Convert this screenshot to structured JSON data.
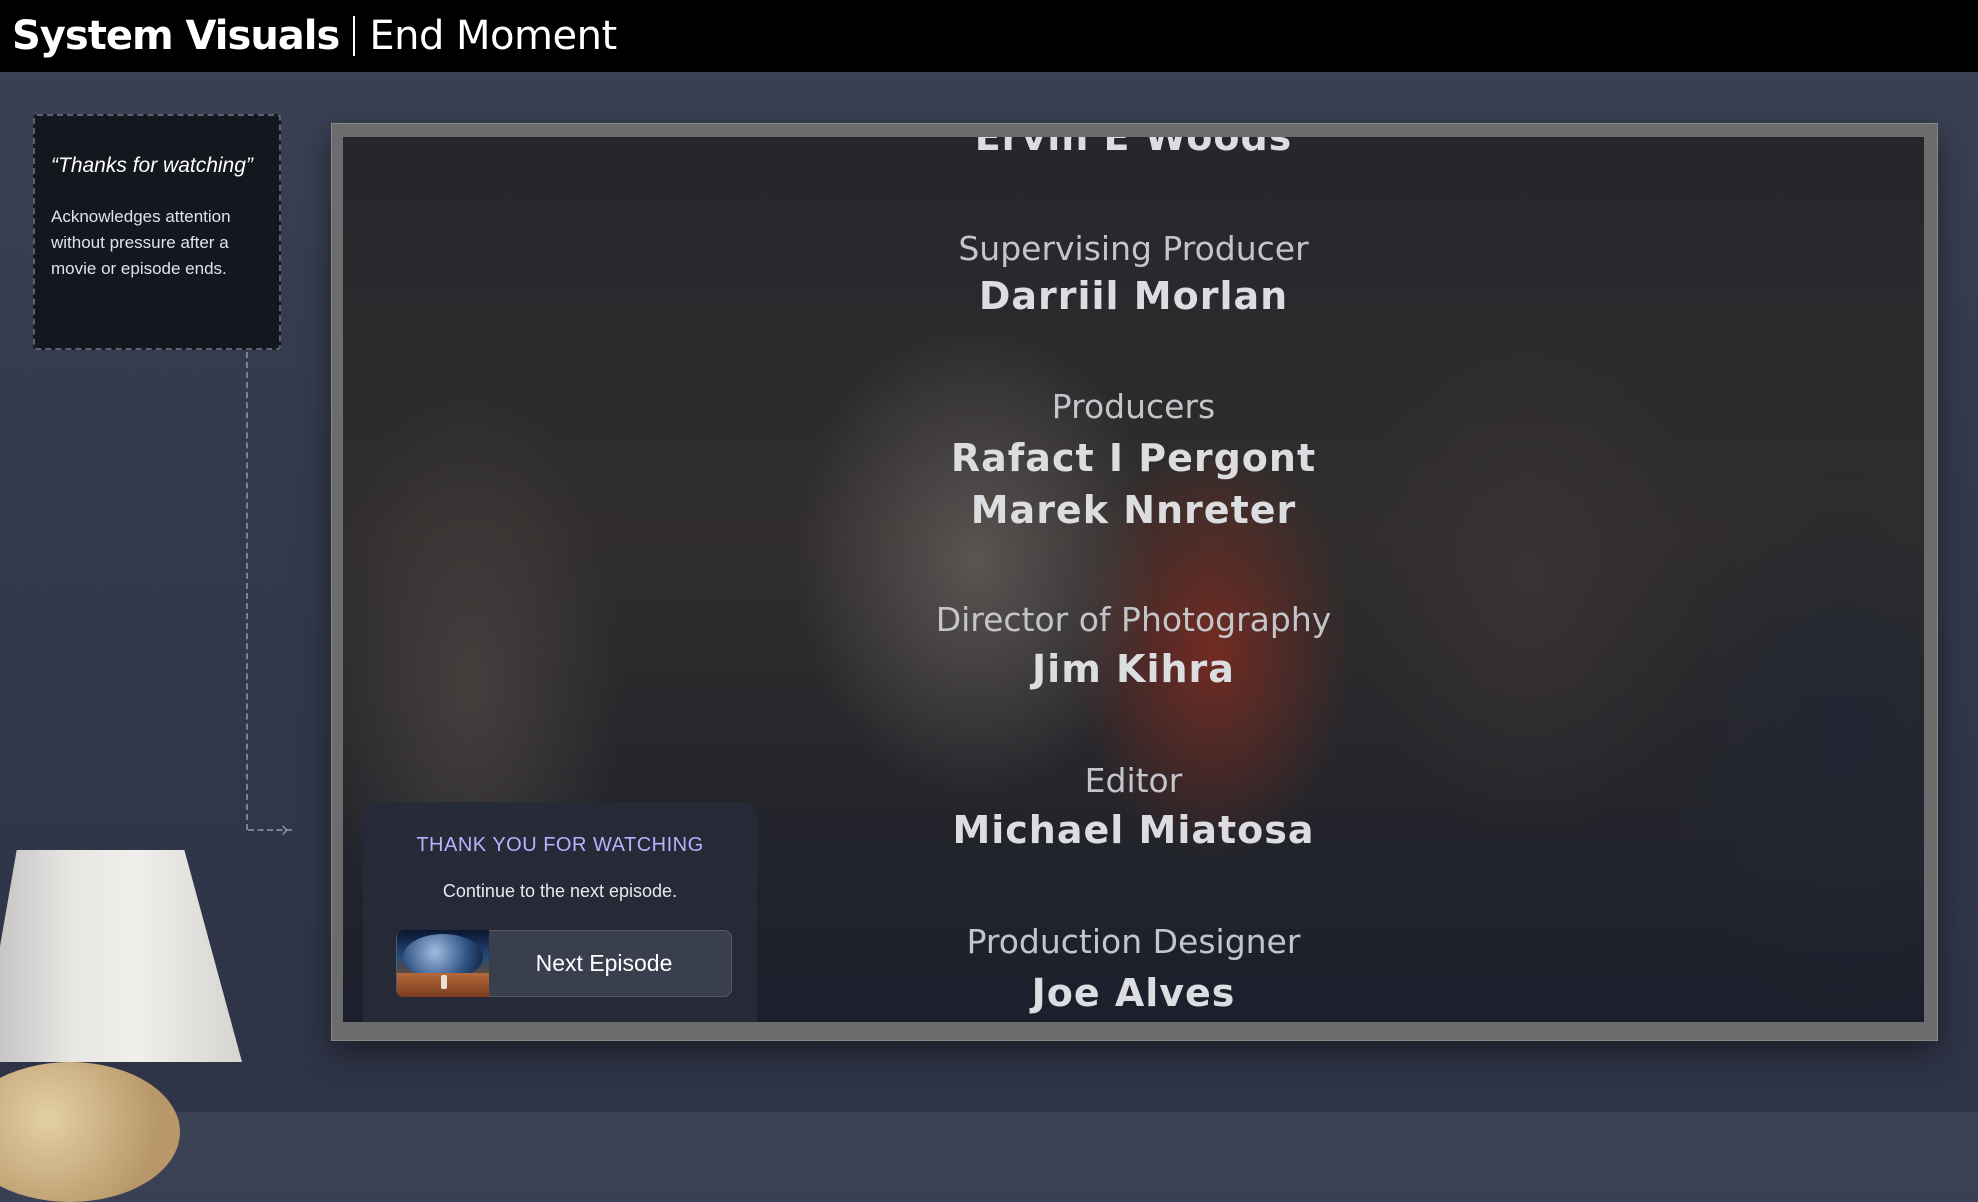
{
  "header": {
    "brand": "System Visuals",
    "subtitle": "End Moment"
  },
  "note": {
    "title": "“Thanks for watching”",
    "body": "Acknowledges attention without pressure after a movie or episode ends."
  },
  "credits": [
    {
      "role": "",
      "names": [
        "Ervin E Woods"
      ]
    },
    {
      "role": "Supervising Producer",
      "names": [
        "Darriil Morlan"
      ]
    },
    {
      "role": "Producers",
      "names": [
        "Rafact I Pergont",
        "Marek Nnreter"
      ]
    },
    {
      "role": "Director of Photography",
      "names": [
        "Jim Kihra"
      ]
    },
    {
      "role": "Editor",
      "names": [
        "Michael Miatosa"
      ]
    },
    {
      "role": "Production Designer",
      "names": [
        "Joe Alves"
      ]
    }
  ],
  "end_card": {
    "heading": "THANK YOU FOR WATCHING",
    "subtext": "Continue to the next episode.",
    "next_button_label": "Next Episode"
  },
  "icons": {
    "arrow": "arrow-right-icon",
    "thumbnail": "episode-thumbnail-astronaut"
  },
  "colors": {
    "accent": "#b9b1ff",
    "topbar": "#000000",
    "wall": "#3c4256"
  }
}
